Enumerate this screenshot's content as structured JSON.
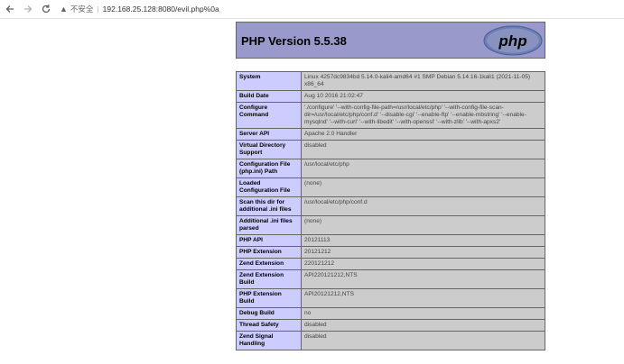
{
  "browser": {
    "security_label": "不安全",
    "url": "192.168.25.128:8080/evil.php%0a"
  },
  "php": {
    "version_title": "PHP Version 5.5.38",
    "logo_text": "php"
  },
  "info_rows": [
    {
      "label": "System",
      "value": "Linux 4257dc9834bd 5.14.0-kali4-amd64 #1 SMP Debian 5.14.16-1kali1 (2021-11-05) x86_64"
    },
    {
      "label": "Build Date",
      "value": "Aug 10 2016 21:02:47"
    },
    {
      "label": "Configure Command",
      "value": "'./configure' '--with-config-file-path=/usr/local/etc/php' '--with-config-file-scan-dir=/usr/local/etc/php/conf.d' '--disable-cgi' '--enable-ftp' '--enable-mbstring' '--enable-mysqlnd' '--with-curl' '--with-libedit' '--with-openssl' '--with-zlib' '--with-apxs2'"
    },
    {
      "label": "Server API",
      "value": "Apache 2.0 Handler"
    },
    {
      "label": "Virtual Directory Support",
      "value": "disabled"
    },
    {
      "label": "Configuration File (php.ini) Path",
      "value": "/usr/local/etc/php"
    },
    {
      "label": "Loaded Configuration File",
      "value": "(none)"
    },
    {
      "label": "Scan this dir for additional .ini files",
      "value": "/usr/local/etc/php/conf.d"
    },
    {
      "label": "Additional .ini files parsed",
      "value": "(none)"
    },
    {
      "label": "PHP API",
      "value": "20121113"
    },
    {
      "label": "PHP Extension",
      "value": "20121212"
    },
    {
      "label": "Zend Extension",
      "value": "220121212"
    },
    {
      "label": "Zend Extension Build",
      "value": "API220121212,NTS"
    },
    {
      "label": "PHP Extension Build",
      "value": "API20121212,NTS"
    },
    {
      "label": "Debug Build",
      "value": "no"
    },
    {
      "label": "Thread Safety",
      "value": "disabled"
    },
    {
      "label": "Zend Signal Handling",
      "value": "disabled"
    }
  ]
}
